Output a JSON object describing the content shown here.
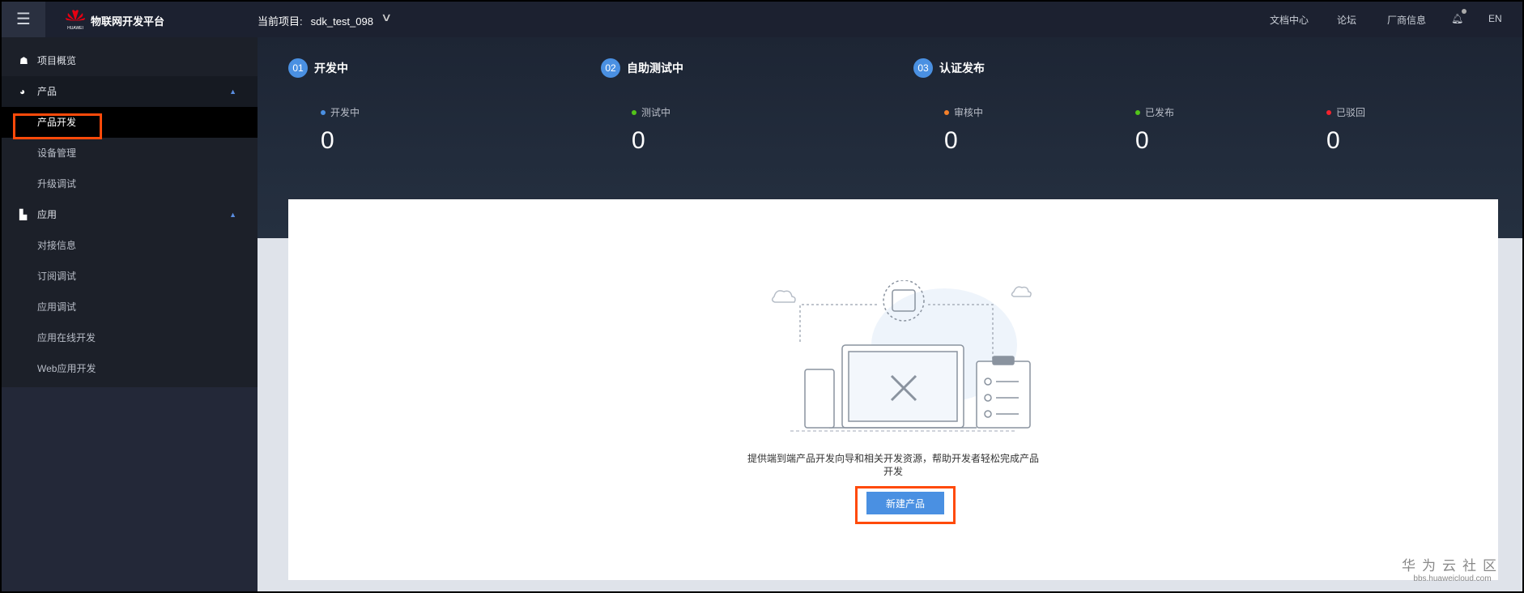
{
  "topbar": {
    "brand": "物联网开发平台",
    "logo_text": "HUAWEI",
    "project_label": "当前项目:",
    "project_value": "sdk_test_098",
    "links": [
      "文档中心",
      "论坛",
      "厂商信息"
    ],
    "lang": "EN"
  },
  "sidebar": {
    "overview": "项目概览",
    "product": "产品",
    "product_items": [
      "产品开发",
      "设备管理",
      "升级调试"
    ],
    "app": "应用",
    "app_items": [
      "对接信息",
      "订阅调试",
      "应用调试",
      "应用在线开发",
      "Web应用开发"
    ]
  },
  "stages": [
    {
      "num": "01",
      "title": "开发中",
      "stats": [
        {
          "label": "开发中",
          "value": "0",
          "color": "#4a90e2"
        }
      ]
    },
    {
      "num": "02",
      "title": "自助测试中",
      "stats": [
        {
          "label": "测试中",
          "value": "0",
          "color": "#52c41a"
        }
      ]
    },
    {
      "num": "03",
      "title": "认证发布",
      "stats": [
        {
          "label": "审核中",
          "value": "0",
          "color": "#f5812a"
        },
        {
          "label": "已发布",
          "value": "0",
          "color": "#52c41a"
        },
        {
          "label": "已驳回",
          "value": "0",
          "color": "#f5222d"
        }
      ]
    }
  ],
  "main": {
    "description_line1": "提供端到端产品开发向导和相关开发资源，帮助开发者轻松完成产品",
    "description_line2": "开发",
    "create_button": "新建产品"
  },
  "watermark": {
    "title": "华为云社区",
    "url": "bbs.huaweicloud.com"
  }
}
